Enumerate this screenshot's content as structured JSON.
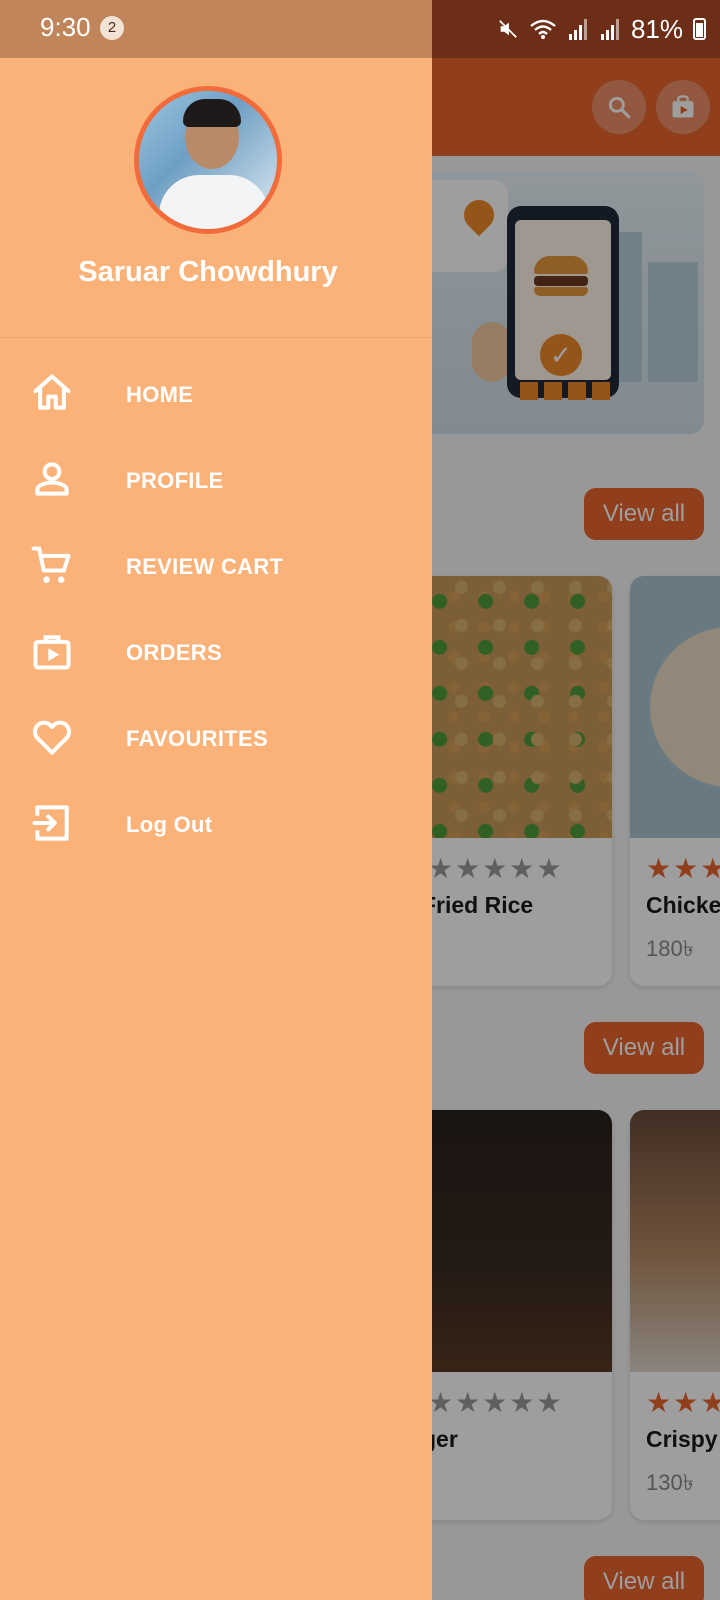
{
  "status_bar": {
    "time": "9:30",
    "notification_count": "2",
    "battery_percent": "81%"
  },
  "drawer": {
    "user_name": "Saruar Chowdhury",
    "items": [
      {
        "label": "HOME",
        "icon": "home-icon"
      },
      {
        "label": "PROFILE",
        "icon": "person-icon"
      },
      {
        "label": "REVIEW CART",
        "icon": "cart-icon"
      },
      {
        "label": "ORDERS",
        "icon": "shopping-bag-icon"
      },
      {
        "label": "FAVOURITES",
        "icon": "heart-icon"
      },
      {
        "label": "Log Out",
        "icon": "logout-icon"
      }
    ]
  },
  "background": {
    "app_bar_icons": [
      "search-icon",
      "shopping-bag-icon"
    ],
    "sections": [
      {
        "view_all_label": "View all",
        "cards": [
          {
            "title": "Fried Rice",
            "price": "",
            "rating": 5
          },
          {
            "title": "Chicke",
            "price": "180৳",
            "rating": 3
          }
        ]
      },
      {
        "view_all_label": "View all",
        "cards": [
          {
            "title": "ger",
            "price": "",
            "rating": 5
          },
          {
            "title": "Crispy",
            "price": "130৳",
            "rating": 3
          }
        ]
      },
      {
        "view_all_label": "View all"
      }
    ],
    "colors": {
      "accent": "#e8642e",
      "drawer": "#fbb279",
      "avatar_ring": "#f26b3a"
    }
  }
}
